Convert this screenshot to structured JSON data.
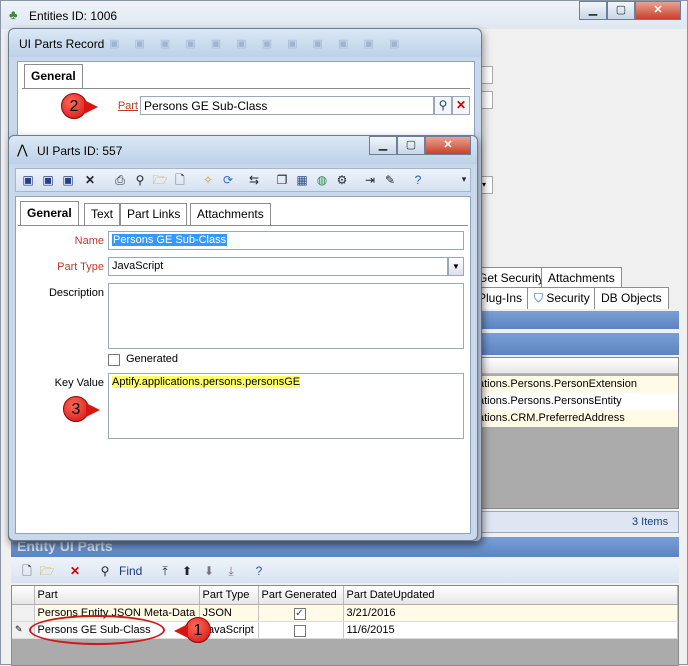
{
  "main_window": {
    "title": "Entities ID: 1006"
  },
  "bg_tabs": [
    "Get Security",
    "Attachments",
    "Plug-Ins",
    "Security",
    "DB Objects"
  ],
  "bg_rows": [
    "ations.Persons.PersonExtension",
    "ations.Persons.PersonsEntity",
    "ations.CRM.PreferredAddress"
  ],
  "items_count": "3 Items",
  "section_header": "Entity UI Parts",
  "find_label": "Find",
  "grid": {
    "columns": [
      "Part",
      "Part Type",
      "Part Generated",
      "Part DateUpdated"
    ],
    "rows": [
      {
        "part": "Persons Entity JSON Meta-Data",
        "type": "JSON",
        "generated": true,
        "date": "3/21/2016"
      },
      {
        "part": "Persons GE Sub-Class",
        "type": "JavaScript",
        "generated": false,
        "date": "11/6/2015"
      }
    ]
  },
  "record_window": {
    "title": "UI Parts Record",
    "tab": "General",
    "part_label": "Part",
    "part_value": "Persons GE Sub-Class"
  },
  "detail_window": {
    "title": "UI Parts ID: 557",
    "tabs": [
      "General",
      "Text",
      "Part Links",
      "Attachments"
    ],
    "name_label": "Name",
    "name_value": "Persons GE Sub-Class",
    "part_type_label": "Part Type",
    "part_type_value": "JavaScript",
    "description_label": "Description",
    "description_value": "",
    "generated_label": "Generated",
    "key_value_label": "Key Value",
    "key_value": "Aptify.applications.persons.personsGE"
  },
  "callouts": [
    "1",
    "2",
    "3"
  ],
  "colors": {
    "accent_red": "#c0392b",
    "highlight": "#ffff66",
    "section_blue": "#5d84c2"
  }
}
